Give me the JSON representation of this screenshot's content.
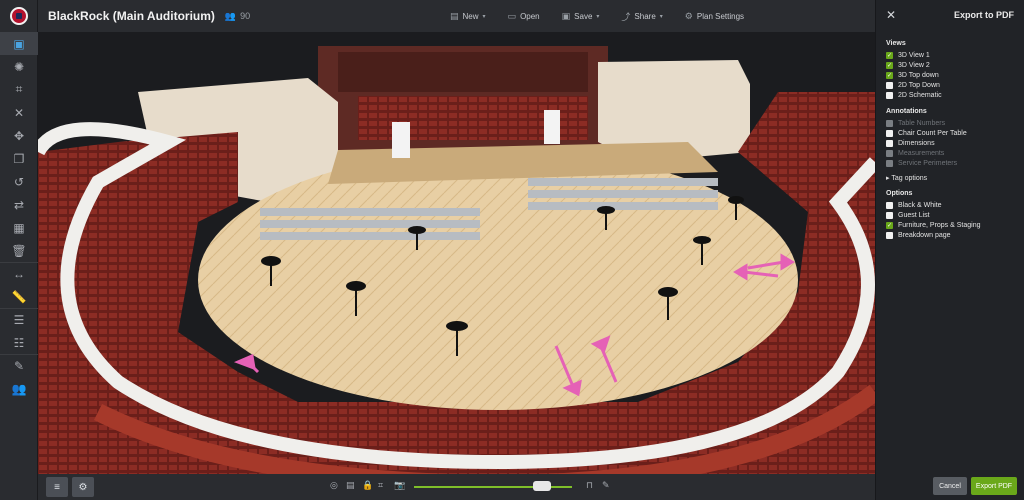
{
  "header": {
    "title": "BlackRock (Main Auditorium)",
    "guest_count": "90"
  },
  "menu": [
    {
      "label": "New",
      "icon": "doc-icon",
      "caret": "▾"
    },
    {
      "label": "Open",
      "icon": "folder-icon",
      "caret": ""
    },
    {
      "label": "Save",
      "icon": "save-icon",
      "caret": "▾"
    },
    {
      "label": "Share",
      "icon": "share-icon",
      "caret": "▾"
    },
    {
      "label": "Plan Settings",
      "icon": "gear-icon",
      "caret": ""
    }
  ],
  "panel": {
    "title": "Export to PDF",
    "views_title": "Views",
    "views": [
      {
        "label": "3D View 1",
        "checked": true
      },
      {
        "label": "3D View 2",
        "checked": true
      },
      {
        "label": "3D Top down",
        "checked": true
      },
      {
        "label": "2D Top Down",
        "checked": false
      },
      {
        "label": "2D Schematic",
        "checked": false
      }
    ],
    "annotations_title": "Annotations",
    "annotations": [
      {
        "label": "Table Numbers",
        "disabled": true
      },
      {
        "label": "Chair Count Per Table",
        "disabled": false
      },
      {
        "label": "Dimensions",
        "disabled": false
      },
      {
        "label": "Measurements",
        "disabled": true
      },
      {
        "label": "Service Perimeters",
        "disabled": true
      }
    ],
    "tag_options": "Tag options",
    "options_title": "Options",
    "options": [
      {
        "label": "Black & White",
        "checked": false
      },
      {
        "label": "Guest List",
        "checked": false
      },
      {
        "label": "Furniture, Props & Staging",
        "checked": true
      },
      {
        "label": "Breakdown page",
        "checked": false
      }
    ],
    "cancel_label": "Cancel",
    "export_label": "Export PDF"
  },
  "zoom": {
    "value": 0.78
  },
  "colors": {
    "accent": "#6aa81a",
    "selected_tool": "#4aa3e0"
  }
}
